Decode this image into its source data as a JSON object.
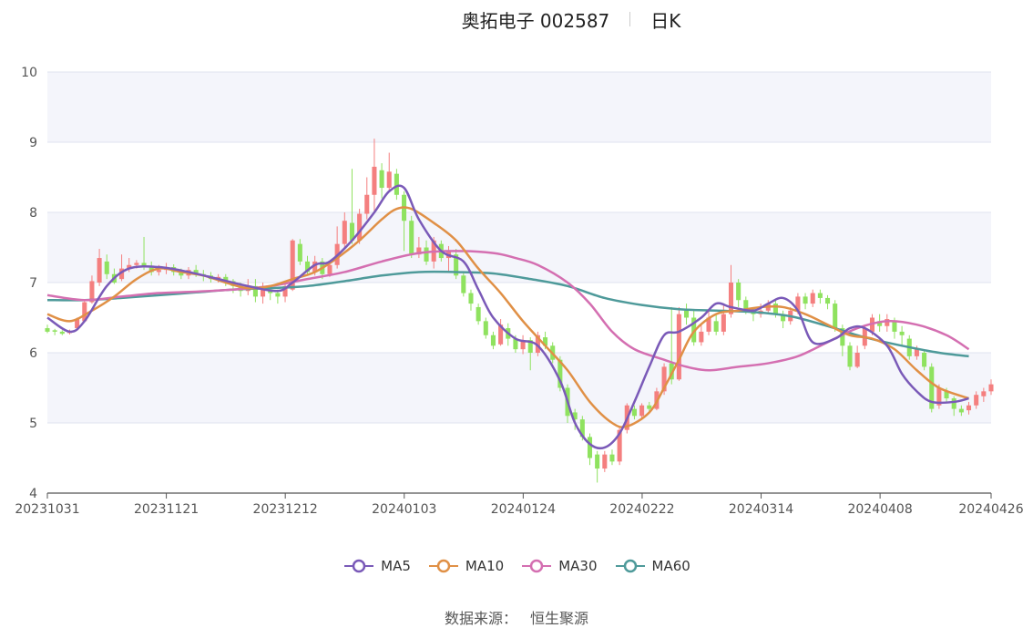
{
  "header": {
    "title": "奥拓电子 002587",
    "period": "日K"
  },
  "source": {
    "label": "数据来源：",
    "value": "恒生聚源"
  },
  "colors": {
    "up": "#f47f7f",
    "down": "#8fe25f",
    "MA5": "#7a5ab8",
    "MA10": "#e09046",
    "MA30": "#d46fb1",
    "MA60": "#4e9a9a",
    "band": "#f4f5fb",
    "grid": "#dfe3ef"
  },
  "chart_data": {
    "type": "candlestick",
    "ylim": [
      4,
      10
    ],
    "yticks": [
      4,
      5,
      6,
      7,
      8,
      9,
      10
    ],
    "xtick_labels": [
      "20231031",
      "20231121",
      "20231212",
      "20240103",
      "20240124",
      "20240222",
      "20240314",
      "20240408",
      "20240426"
    ],
    "xtick_index": [
      0,
      15,
      30,
      45,
      60,
      75,
      90,
      105,
      119
    ],
    "legend": [
      "MA5",
      "MA10",
      "MA30",
      "MA60"
    ],
    "candles": [
      [
        6.35,
        6.3,
        6.4,
        6.28
      ],
      [
        6.32,
        6.3,
        6.34,
        6.25
      ],
      [
        6.3,
        6.27,
        6.32,
        6.25
      ],
      [
        6.28,
        6.3,
        6.33,
        6.26
      ],
      [
        6.35,
        6.48,
        6.5,
        6.33
      ],
      [
        6.45,
        6.72,
        6.75,
        6.43
      ],
      [
        6.72,
        7.02,
        7.1,
        6.7
      ],
      [
        7.0,
        7.35,
        7.48,
        6.95
      ],
      [
        7.3,
        7.12,
        7.4,
        7.05
      ],
      [
        7.12,
        7.0,
        7.2,
        6.98
      ],
      [
        7.05,
        7.2,
        7.4,
        7.02
      ],
      [
        7.2,
        7.25,
        7.35,
        7.15
      ],
      [
        7.25,
        7.28,
        7.32,
        7.2
      ],
      [
        7.28,
        7.22,
        7.65,
        7.18
      ],
      [
        7.22,
        7.15,
        7.3,
        7.1
      ],
      [
        7.15,
        7.18,
        7.25,
        7.1
      ],
      [
        7.18,
        7.22,
        7.28,
        7.12
      ],
      [
        7.22,
        7.15,
        7.26,
        7.1
      ],
      [
        7.15,
        7.1,
        7.2,
        7.05
      ],
      [
        7.1,
        7.18,
        7.22,
        7.05
      ],
      [
        7.18,
        7.12,
        7.25,
        7.08
      ],
      [
        7.12,
        7.1,
        7.18,
        7.02
      ],
      [
        7.1,
        7.05,
        7.15,
        7.0
      ],
      [
        7.05,
        7.08,
        7.12,
        7.0
      ],
      [
        7.08,
        7.02,
        7.12,
        6.95
      ],
      [
        7.02,
        6.95,
        7.05,
        6.85
      ],
      [
        6.95,
        6.88,
        7.0,
        6.8
      ],
      [
        6.88,
        6.95,
        7.05,
        6.82
      ],
      [
        6.95,
        6.8,
        7.05,
        6.72
      ],
      [
        6.8,
        6.9,
        7.0,
        6.7
      ],
      [
        6.9,
        6.85,
        6.95,
        6.75
      ],
      [
        6.85,
        6.8,
        6.9,
        6.7
      ],
      [
        6.8,
        6.95,
        7.0,
        6.72
      ],
      [
        6.9,
        7.6,
        7.62,
        6.88
      ],
      [
        7.55,
        7.3,
        7.62,
        7.25
      ],
      [
        7.3,
        7.15,
        7.38,
        7.1
      ],
      [
        7.15,
        7.3,
        7.38,
        7.1
      ],
      [
        7.3,
        7.12,
        7.35,
        7.05
      ],
      [
        7.12,
        7.25,
        7.3,
        7.08
      ],
      [
        7.25,
        7.55,
        7.8,
        7.2
      ],
      [
        7.55,
        7.88,
        8.0,
        7.5
      ],
      [
        7.85,
        7.6,
        8.62,
        7.55
      ],
      [
        7.6,
        7.98,
        8.05,
        7.55
      ],
      [
        7.98,
        8.25,
        8.5,
        7.9
      ],
      [
        8.25,
        8.65,
        9.05,
        8.0
      ],
      [
        8.6,
        8.35,
        8.7,
        8.2
      ],
      [
        8.35,
        8.58,
        8.85,
        8.3
      ],
      [
        8.55,
        8.25,
        8.62,
        8.18
      ],
      [
        8.25,
        7.88,
        8.3,
        7.45
      ],
      [
        7.88,
        7.4,
        7.95,
        7.35
      ],
      [
        7.4,
        7.5,
        7.65,
        7.35
      ],
      [
        7.5,
        7.3,
        7.6,
        7.25
      ],
      [
        7.3,
        7.6,
        7.65,
        7.2
      ],
      [
        7.55,
        7.35,
        7.6,
        7.3
      ],
      [
        7.35,
        7.45,
        7.52,
        7.15
      ],
      [
        7.4,
        7.1,
        7.48,
        7.05
      ],
      [
        7.1,
        6.85,
        7.15,
        6.8
      ],
      [
        6.85,
        6.7,
        6.9,
        6.6
      ],
      [
        6.65,
        6.45,
        6.7,
        6.4
      ],
      [
        6.45,
        6.25,
        6.5,
        6.2
      ],
      [
        6.25,
        6.1,
        6.3,
        6.05
      ],
      [
        6.12,
        6.4,
        6.48,
        6.1
      ],
      [
        6.35,
        6.2,
        6.42,
        6.1
      ],
      [
        6.2,
        6.05,
        6.25,
        6.0
      ],
      [
        6.05,
        6.18,
        6.25,
        5.98
      ],
      [
        6.18,
        6.0,
        6.22,
        5.75
      ],
      [
        6.0,
        6.25,
        6.3,
        5.95
      ],
      [
        6.22,
        6.1,
        6.3,
        6.05
      ],
      [
        6.1,
        5.9,
        6.15,
        5.85
      ],
      [
        5.9,
        5.5,
        5.95,
        5.45
      ],
      [
        5.5,
        5.1,
        5.55,
        5.0
      ],
      [
        5.15,
        5.05,
        5.2,
        4.9
      ],
      [
        5.05,
        4.8,
        5.1,
        4.75
      ],
      [
        4.8,
        4.5,
        4.85,
        4.4
      ],
      [
        4.55,
        4.35,
        4.6,
        4.15
      ],
      [
        4.35,
        4.55,
        4.6,
        4.3
      ],
      [
        4.55,
        4.45,
        4.62,
        4.4
      ],
      [
        4.45,
        4.9,
        4.95,
        4.4
      ],
      [
        4.9,
        5.25,
        5.28,
        4.85
      ],
      [
        5.2,
        5.1,
        5.25,
        5.05
      ],
      [
        5.1,
        5.25,
        5.28,
        5.05
      ],
      [
        5.25,
        5.2,
        5.3,
        5.15
      ],
      [
        5.2,
        5.45,
        5.5,
        5.18
      ],
      [
        5.45,
        5.8,
        5.85,
        5.4
      ],
      [
        5.85,
        5.62,
        6.65,
        5.55
      ],
      [
        5.62,
        6.55,
        6.65,
        5.6
      ],
      [
        6.6,
        6.5,
        6.7,
        6.4
      ],
      [
        6.5,
        6.15,
        6.6,
        6.1
      ],
      [
        6.15,
        6.3,
        6.4,
        6.1
      ],
      [
        6.3,
        6.5,
        6.6,
        6.25
      ],
      [
        6.45,
        6.3,
        6.55,
        6.25
      ],
      [
        6.3,
        6.55,
        6.7,
        6.25
      ],
      [
        6.55,
        7.0,
        7.25,
        6.5
      ],
      [
        7.0,
        6.75,
        7.05,
        6.65
      ],
      [
        6.75,
        6.62,
        6.8,
        6.55
      ],
      [
        6.62,
        6.55,
        6.65,
        6.45
      ],
      [
        6.55,
        6.6,
        6.7,
        6.5
      ],
      [
        6.6,
        6.7,
        6.75,
        6.55
      ],
      [
        6.7,
        6.55,
        6.75,
        6.5
      ],
      [
        6.55,
        6.45,
        6.6,
        6.35
      ],
      [
        6.45,
        6.6,
        6.65,
        6.4
      ],
      [
        6.6,
        6.8,
        6.85,
        6.55
      ],
      [
        6.8,
        6.7,
        6.85,
        6.62
      ],
      [
        6.7,
        6.85,
        6.9,
        6.65
      ],
      [
        6.85,
        6.78,
        6.9,
        6.7
      ],
      [
        6.78,
        6.7,
        6.82,
        6.62
      ],
      [
        6.7,
        6.35,
        6.75,
        6.3
      ],
      [
        6.35,
        6.1,
        6.4,
        5.95
      ],
      [
        6.1,
        5.8,
        6.15,
        5.75
      ],
      [
        5.8,
        6.0,
        6.1,
        5.78
      ],
      [
        6.1,
        6.35,
        6.4,
        6.05
      ],
      [
        6.3,
        6.5,
        6.55,
        6.25
      ],
      [
        6.45,
        6.38,
        6.55,
        6.3
      ],
      [
        6.38,
        6.48,
        6.55,
        6.3
      ],
      [
        6.45,
        6.3,
        6.5,
        6.2
      ],
      [
        6.3,
        6.25,
        6.38,
        6.1
      ],
      [
        6.2,
        5.95,
        6.25,
        5.9
      ],
      [
        5.95,
        6.05,
        6.1,
        5.9
      ],
      [
        6.0,
        5.8,
        6.05,
        5.75
      ],
      [
        5.8,
        5.2,
        5.85,
        5.15
      ],
      [
        5.25,
        5.5,
        5.55,
        5.2
      ],
      [
        5.45,
        5.35,
        5.5,
        5.28
      ],
      [
        5.35,
        5.2,
        5.38,
        5.1
      ],
      [
        5.2,
        5.15,
        5.25,
        5.1
      ],
      [
        5.18,
        5.25,
        5.3,
        5.12
      ],
      [
        5.25,
        5.4,
        5.45,
        5.2
      ],
      [
        5.38,
        5.45,
        5.5,
        5.3
      ],
      [
        5.45,
        5.55,
        5.62,
        5.4
      ]
    ],
    "ma": {
      "MA5": [
        [
          0,
          6.5
        ],
        [
          3,
          6.3
        ],
        [
          5,
          6.45
        ],
        [
          8,
          6.95
        ],
        [
          11,
          7.2
        ],
        [
          15,
          7.22
        ],
        [
          19,
          7.15
        ],
        [
          23,
          7.05
        ],
        [
          27,
          6.95
        ],
        [
          31,
          6.88
        ],
        [
          33,
          7.0
        ],
        [
          36,
          7.25
        ],
        [
          38,
          7.3
        ],
        [
          41,
          7.6
        ],
        [
          44,
          8.0
        ],
        [
          46,
          8.3
        ],
        [
          48,
          8.35
        ],
        [
          50,
          7.9
        ],
        [
          53,
          7.45
        ],
        [
          56,
          7.3
        ],
        [
          58,
          6.9
        ],
        [
          60,
          6.5
        ],
        [
          63,
          6.2
        ],
        [
          66,
          6.1
        ],
        [
          69,
          5.6
        ],
        [
          71,
          5.0
        ],
        [
          73,
          4.7
        ],
        [
          75,
          4.65
        ],
        [
          77,
          4.85
        ],
        [
          79,
          5.3
        ],
        [
          81,
          5.8
        ],
        [
          83,
          6.25
        ],
        [
          85,
          6.3
        ],
        [
          88,
          6.5
        ],
        [
          90,
          6.7
        ],
        [
          92,
          6.65
        ],
        [
          95,
          6.6
        ],
        [
          97,
          6.7
        ],
        [
          99,
          6.78
        ],
        [
          101,
          6.6
        ],
        [
          103,
          6.15
        ],
        [
          106,
          6.2
        ],
        [
          108,
          6.35
        ],
        [
          110,
          6.35
        ],
        [
          113,
          6.1
        ],
        [
          115,
          5.7
        ],
        [
          117,
          5.45
        ],
        [
          119,
          5.3
        ],
        [
          122,
          5.3
        ],
        [
          124,
          5.35
        ]
      ],
      "MA10": [
        [
          0,
          6.55
        ],
        [
          3,
          6.45
        ],
        [
          6,
          6.6
        ],
        [
          9,
          6.8
        ],
        [
          12,
          7.05
        ],
        [
          15,
          7.2
        ],
        [
          18,
          7.15
        ],
        [
          21,
          7.1
        ],
        [
          24,
          7.0
        ],
        [
          27,
          6.92
        ],
        [
          30,
          6.95
        ],
        [
          33,
          7.05
        ],
        [
          36,
          7.15
        ],
        [
          39,
          7.35
        ],
        [
          42,
          7.6
        ],
        [
          45,
          7.9
        ],
        [
          47,
          8.05
        ],
        [
          49,
          8.05
        ],
        [
          52,
          7.85
        ],
        [
          55,
          7.6
        ],
        [
          58,
          7.2
        ],
        [
          61,
          6.85
        ],
        [
          64,
          6.45
        ],
        [
          67,
          6.1
        ],
        [
          70,
          5.75
        ],
        [
          73,
          5.3
        ],
        [
          76,
          5.0
        ],
        [
          78,
          4.95
        ],
        [
          81,
          5.15
        ],
        [
          83,
          5.5
        ],
        [
          85,
          5.9
        ],
        [
          87,
          6.3
        ],
        [
          90,
          6.55
        ],
        [
          93,
          6.6
        ],
        [
          96,
          6.65
        ],
        [
          99,
          6.65
        ],
        [
          102,
          6.55
        ],
        [
          105,
          6.4
        ],
        [
          108,
          6.25
        ],
        [
          111,
          6.2
        ],
        [
          114,
          6.05
        ],
        [
          117,
          5.75
        ],
        [
          120,
          5.5
        ],
        [
          124,
          5.35
        ]
      ],
      "MA30": [
        [
          0,
          6.82
        ],
        [
          5,
          6.75
        ],
        [
          10,
          6.8
        ],
        [
          15,
          6.85
        ],
        [
          20,
          6.87
        ],
        [
          25,
          6.9
        ],
        [
          30,
          6.95
        ],
        [
          35,
          7.05
        ],
        [
          40,
          7.15
        ],
        [
          45,
          7.3
        ],
        [
          50,
          7.42
        ],
        [
          55,
          7.45
        ],
        [
          60,
          7.42
        ],
        [
          63,
          7.35
        ],
        [
          66,
          7.25
        ],
        [
          70,
          7.0
        ],
        [
          73,
          6.7
        ],
        [
          76,
          6.3
        ],
        [
          79,
          6.05
        ],
        [
          83,
          5.9
        ],
        [
          86,
          5.8
        ],
        [
          89,
          5.75
        ],
        [
          93,
          5.8
        ],
        [
          97,
          5.85
        ],
        [
          101,
          5.95
        ],
        [
          105,
          6.15
        ],
        [
          109,
          6.35
        ],
        [
          113,
          6.45
        ],
        [
          117,
          6.4
        ],
        [
          121,
          6.25
        ],
        [
          124,
          6.05
        ]
      ],
      "MA60": [
        [
          0,
          6.75
        ],
        [
          5,
          6.75
        ],
        [
          10,
          6.78
        ],
        [
          15,
          6.82
        ],
        [
          20,
          6.86
        ],
        [
          25,
          6.9
        ],
        [
          30,
          6.92
        ],
        [
          35,
          6.95
        ],
        [
          40,
          7.02
        ],
        [
          45,
          7.1
        ],
        [
          50,
          7.15
        ],
        [
          55,
          7.15
        ],
        [
          60,
          7.13
        ],
        [
          65,
          7.05
        ],
        [
          70,
          6.95
        ],
        [
          75,
          6.78
        ],
        [
          80,
          6.68
        ],
        [
          85,
          6.62
        ],
        [
          90,
          6.6
        ],
        [
          95,
          6.58
        ],
        [
          100,
          6.52
        ],
        [
          105,
          6.38
        ],
        [
          110,
          6.22
        ],
        [
          115,
          6.1
        ],
        [
          120,
          6.0
        ],
        [
          124,
          5.95
        ]
      ]
    }
  }
}
